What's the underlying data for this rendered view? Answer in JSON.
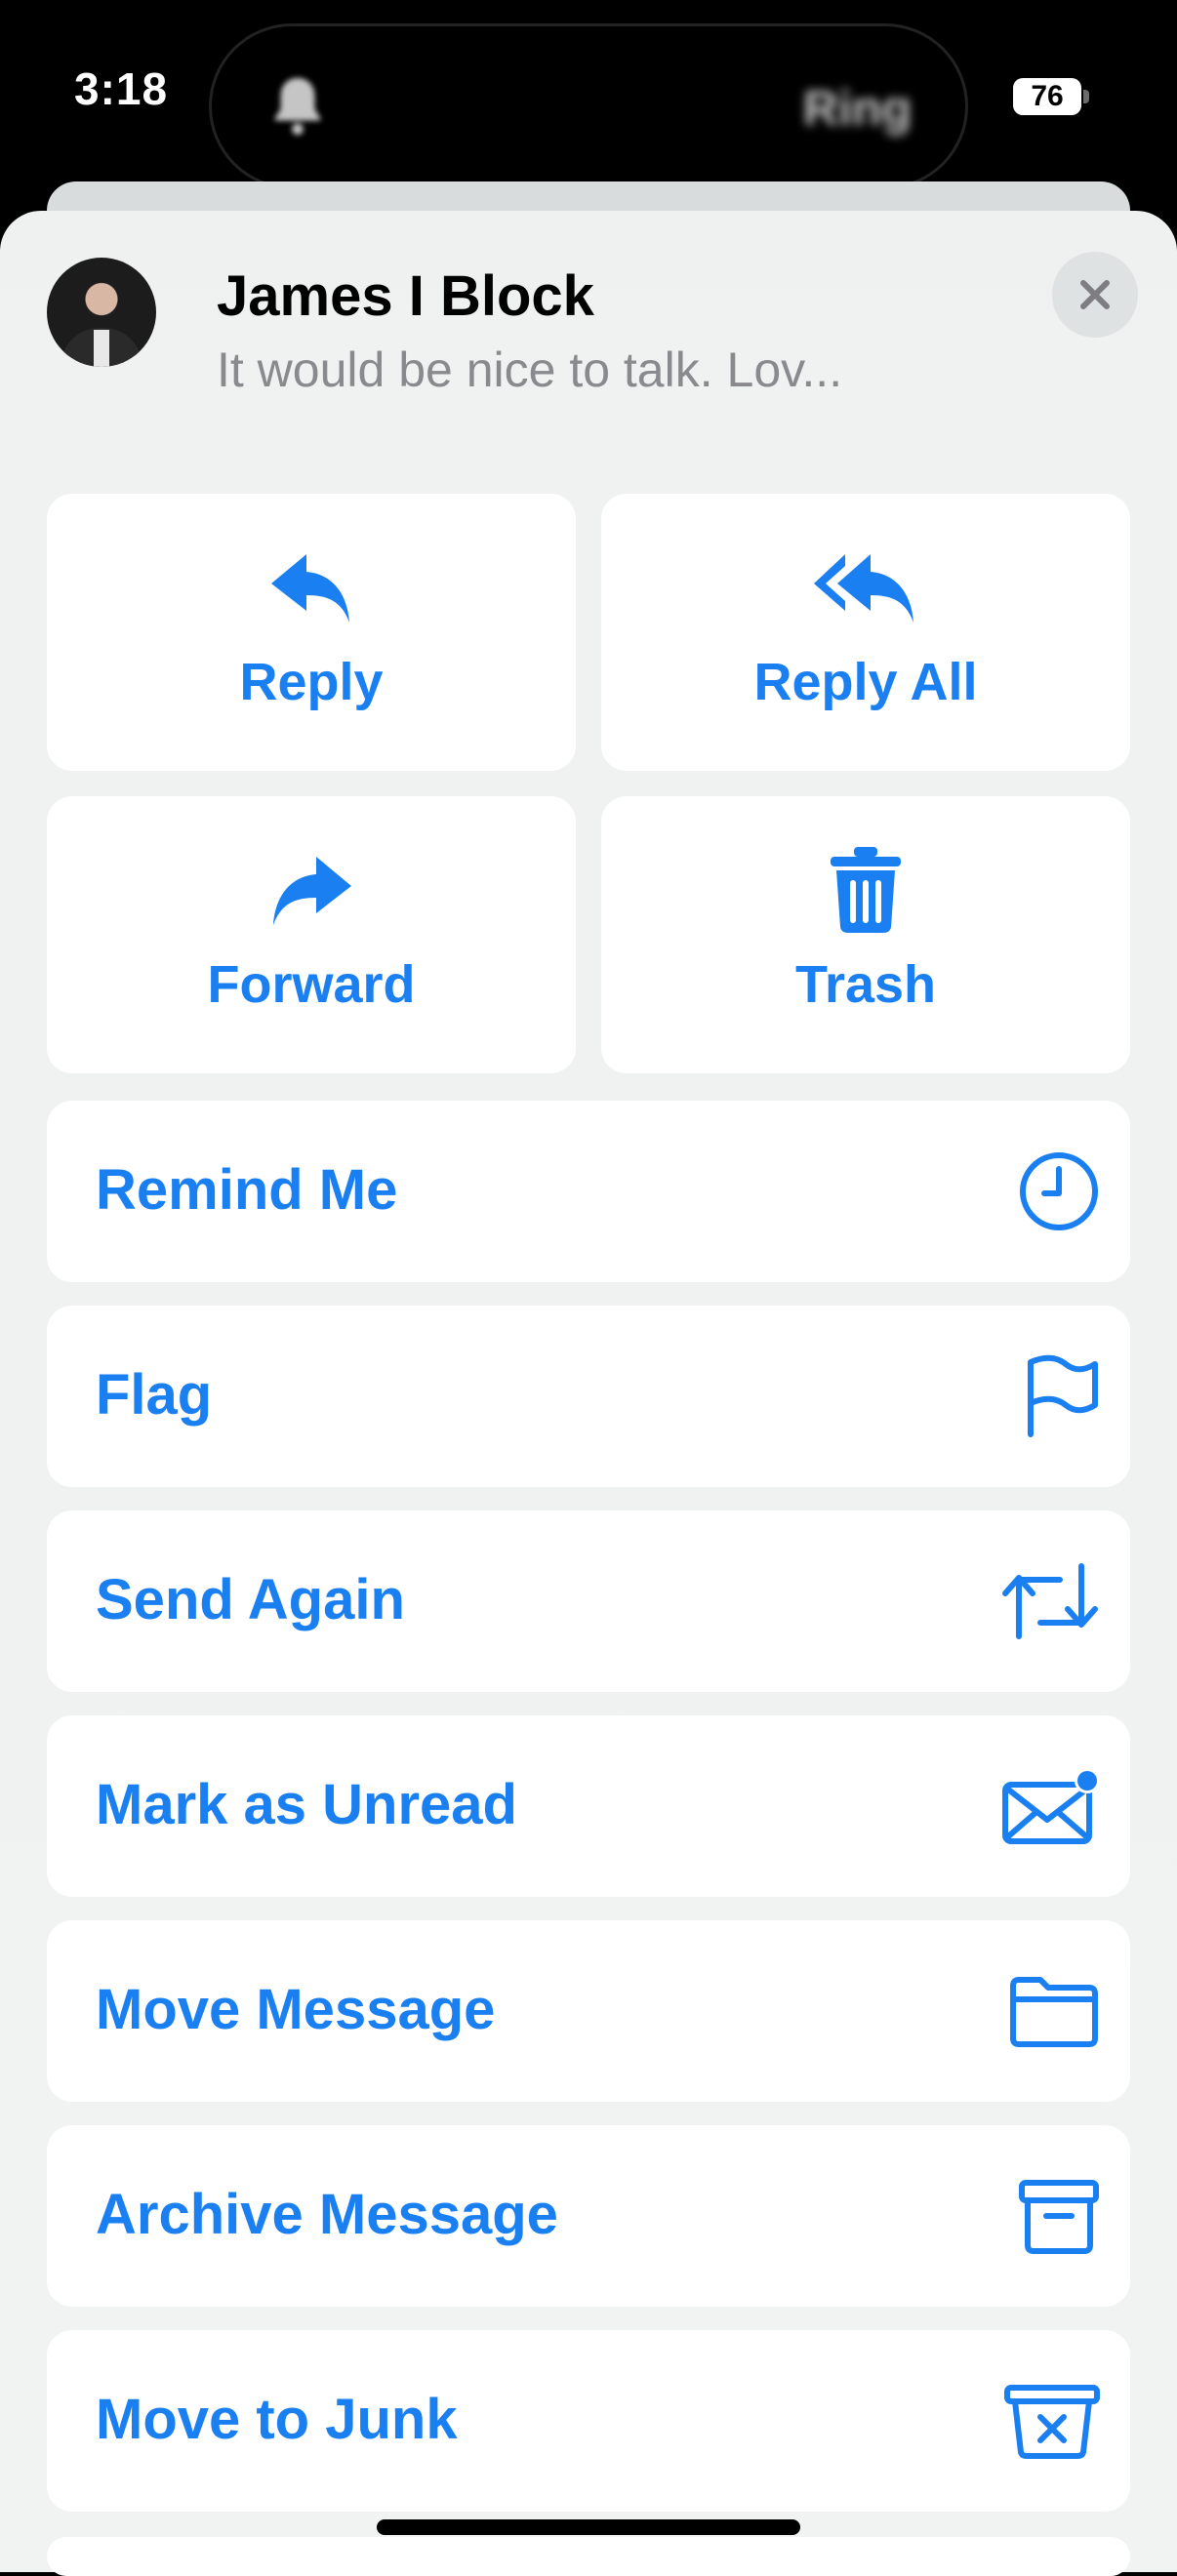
{
  "status_bar": {
    "time": "3:18",
    "island_text": "Ring",
    "battery": "76"
  },
  "header": {
    "sender": "James I Block",
    "preview": "It would be nice to talk. Lov..."
  },
  "actions": {
    "reply": "Reply",
    "reply_all": "Reply All",
    "forward": "Forward",
    "trash": "Trash"
  },
  "menu": {
    "remind_me": "Remind Me",
    "flag": "Flag",
    "send_again": "Send Again",
    "mark_unread": "Mark as Unread",
    "move_message": "Move Message",
    "archive_message": "Archive Message",
    "move_to_junk": "Move to Junk"
  },
  "icons": {
    "reply": "reply-arrow-icon",
    "reply_all": "reply-all-arrow-icon",
    "forward": "forward-arrow-icon",
    "trash": "trash-can-icon",
    "remind_me": "clock-icon",
    "flag": "flag-icon",
    "send_again": "resend-arrows-icon",
    "mark_unread": "envelope-unread-icon",
    "move_message": "folder-icon",
    "archive_message": "archive-box-icon",
    "move_to_junk": "junk-bin-icon",
    "close": "close-icon"
  },
  "colors": {
    "accent": "#1a7ff0",
    "sheet_background": "#f1f2f2",
    "tile_background": "#ffffff",
    "secondary_text": "#8a8a8e"
  }
}
